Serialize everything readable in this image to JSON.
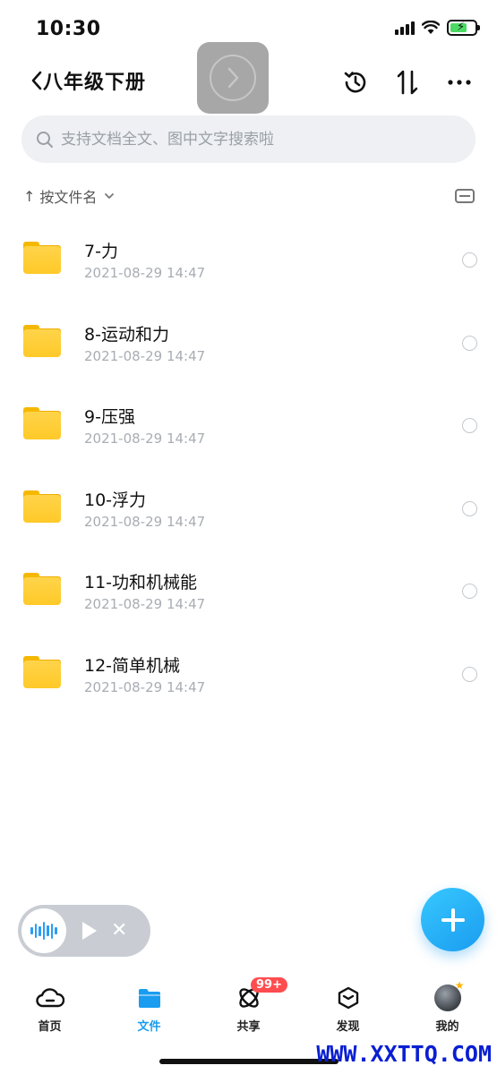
{
  "status_bar": {
    "time": "10:30"
  },
  "header": {
    "title": "八年级下册"
  },
  "search": {
    "placeholder": "支持文档全文、图中文字搜索啦"
  },
  "sort": {
    "label": "按文件名"
  },
  "files": [
    {
      "name": "7-力",
      "time": "2021-08-29 14:47"
    },
    {
      "name": "8-运动和力",
      "time": "2021-08-29 14:47"
    },
    {
      "name": "9-压强",
      "time": "2021-08-29 14:47"
    },
    {
      "name": "10-浮力",
      "time": "2021-08-29 14:47"
    },
    {
      "name": "11-功和机械能",
      "time": "2021-08-29 14:47"
    },
    {
      "name": "12-简单机械",
      "time": "2021-08-29 14:47"
    }
  ],
  "nav": {
    "items": [
      {
        "label": "首页",
        "icon": "cloud-icon"
      },
      {
        "label": "文件",
        "icon": "folder-icon"
      },
      {
        "label": "共享",
        "icon": "share-orbit-icon",
        "badge": "99+"
      },
      {
        "label": "发现",
        "icon": "cube-icon"
      },
      {
        "label": "我的",
        "icon": "avatar"
      }
    ]
  },
  "colors": {
    "accent": "#1a9cf0",
    "folder": "#ffc928",
    "badge": "#ff4d4f",
    "watermark": "#0a1fd1"
  },
  "watermark": "WWW.XXTTQ.COM"
}
